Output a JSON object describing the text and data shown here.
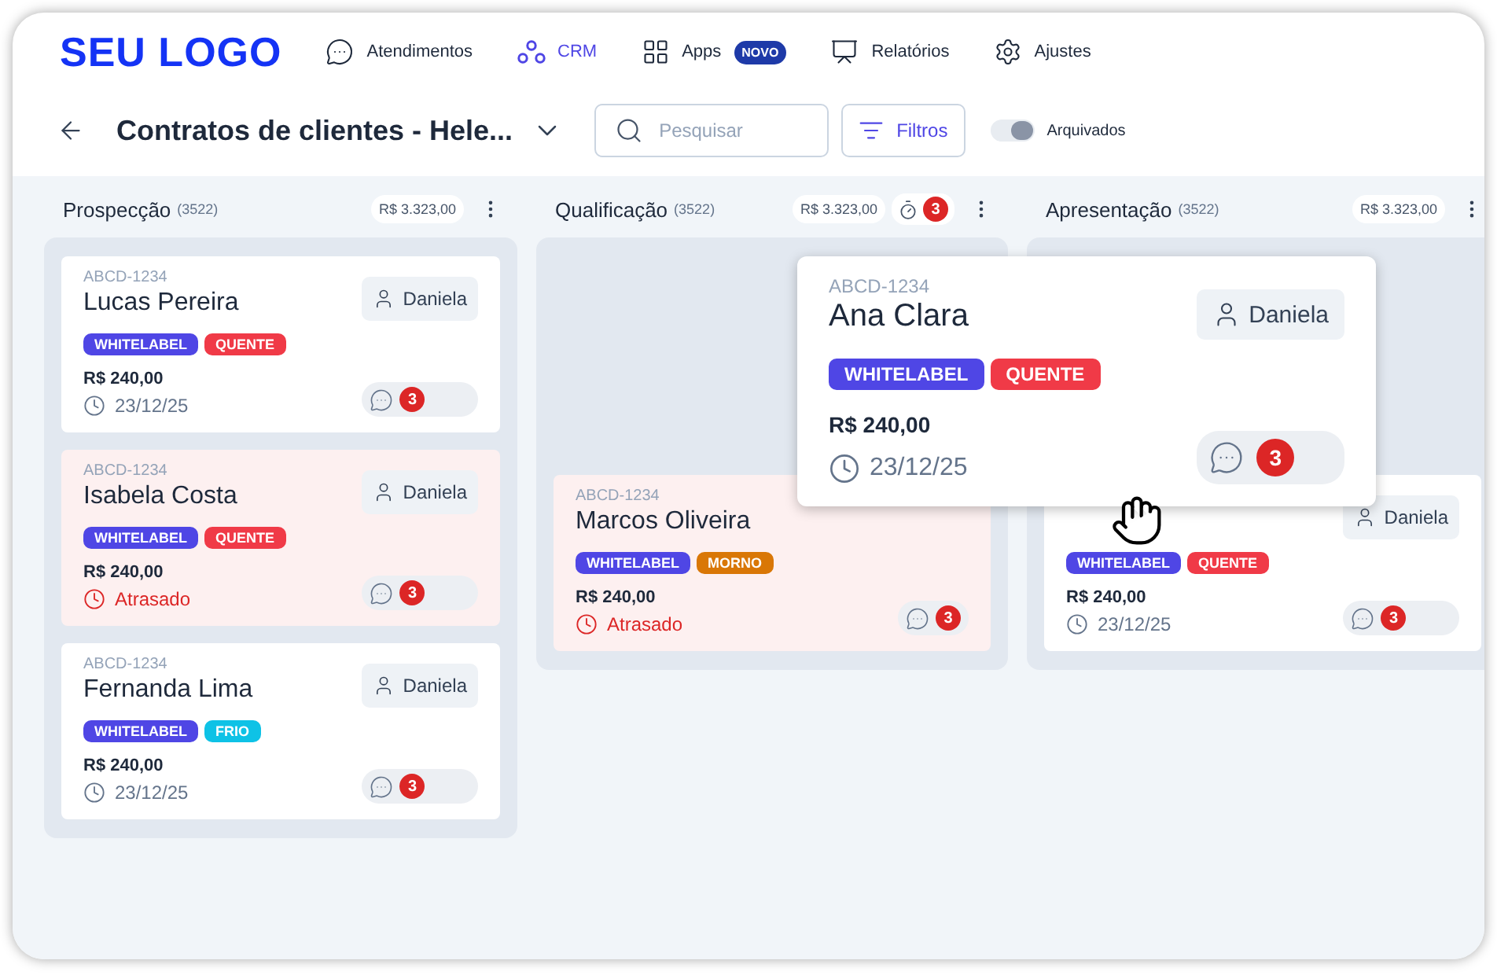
{
  "logo": "SEU LOGO",
  "nav": [
    {
      "label": "Atendimentos",
      "kind": "chat",
      "selected": false
    },
    {
      "label": "CRM",
      "kind": "crm",
      "selected": true
    },
    {
      "label": "Apps",
      "kind": "apps",
      "selected": false,
      "badge": "NOVO"
    },
    {
      "label": "Relatórios",
      "kind": "reports",
      "selected": false
    },
    {
      "label": "Ajustes",
      "kind": "settings",
      "selected": false
    }
  ],
  "toolbar": {
    "title": "Contratos de clientes - Hele...",
    "search": {
      "placeholder": "Pesquisar"
    },
    "filter_button": "Filtros",
    "archived": {
      "label": "Arquivados",
      "on": true
    }
  },
  "columns": [
    {
      "name": "Prospecção",
      "count": "(3522)",
      "amount": "R$ 3.323,00",
      "drop_slot": false,
      "cards": [
        {
          "code": "ABCD-1234",
          "name": "Lucas Pereira",
          "assignee": "Daniela",
          "tags": [
            {
              "label": "WHITELABEL",
              "color": "#4f46e5"
            },
            {
              "label": "QUENTE",
              "color": "#f03a47"
            }
          ],
          "value": "R$ 240,00",
          "due": "23/12/25",
          "overdue": false,
          "comments": "3"
        },
        {
          "code": "ABCD-1234",
          "name": "Isabela Costa",
          "assignee": "Daniela",
          "tags": [
            {
              "label": "WHITELABEL",
              "color": "#4f46e5"
            },
            {
              "label": "QUENTE",
              "color": "#f03a47"
            }
          ],
          "value": "R$ 240,00",
          "due": "Atrasado",
          "overdue": true,
          "comments": "3"
        },
        {
          "code": "ABCD-1234",
          "name": "Fernanda Lima",
          "assignee": "Daniela",
          "tags": [
            {
              "label": "WHITELABEL",
              "color": "#4f46e5"
            },
            {
              "label": "FRIO",
              "color": "#0ec2e6"
            }
          ],
          "value": "R$ 240,00",
          "due": "23/12/25",
          "overdue": false,
          "comments": "3"
        }
      ]
    },
    {
      "name": "Qualificação",
      "count": "(3522)",
      "amount": "R$ 3.323,00",
      "alerts": "3",
      "drop_slot": true,
      "cards": [
        {
          "code": "ABCD-1234",
          "name": "Marcos Oliveira",
          "tags": [
            {
              "label": "WHITELABEL",
              "color": "#4f46e5"
            },
            {
              "label": "MORNO",
              "color": "#d97706"
            }
          ],
          "value": "R$ 240,00",
          "due": "Atrasado",
          "overdue": true,
          "comments": "3"
        }
      ]
    },
    {
      "name": "Apresentação",
      "count": "(3522)",
      "amount": "R$ 3.323,00",
      "drop_slot": true,
      "cards": [
        {
          "assignee": "Daniela",
          "tags": [
            {
              "label": "WHITELABEL",
              "color": "#4f46e5"
            },
            {
              "label": "QUENTE",
              "color": "#f03a47"
            }
          ],
          "value": "R$ 240,00",
          "due": "23/12/25",
          "overdue": false,
          "comments": "3"
        }
      ]
    }
  ],
  "dragged_card": {
    "code": "ABCD-1234",
    "name": "Ana Clara",
    "assignee": "Daniela",
    "tags": [
      {
        "label": "WHITELABEL",
        "color": "#4f46e5"
      },
      {
        "label": "QUENTE",
        "color": "#f03a47"
      }
    ],
    "value": "R$ 240,00",
    "due": "23/12/25",
    "overdue": false,
    "comments": "3"
  }
}
